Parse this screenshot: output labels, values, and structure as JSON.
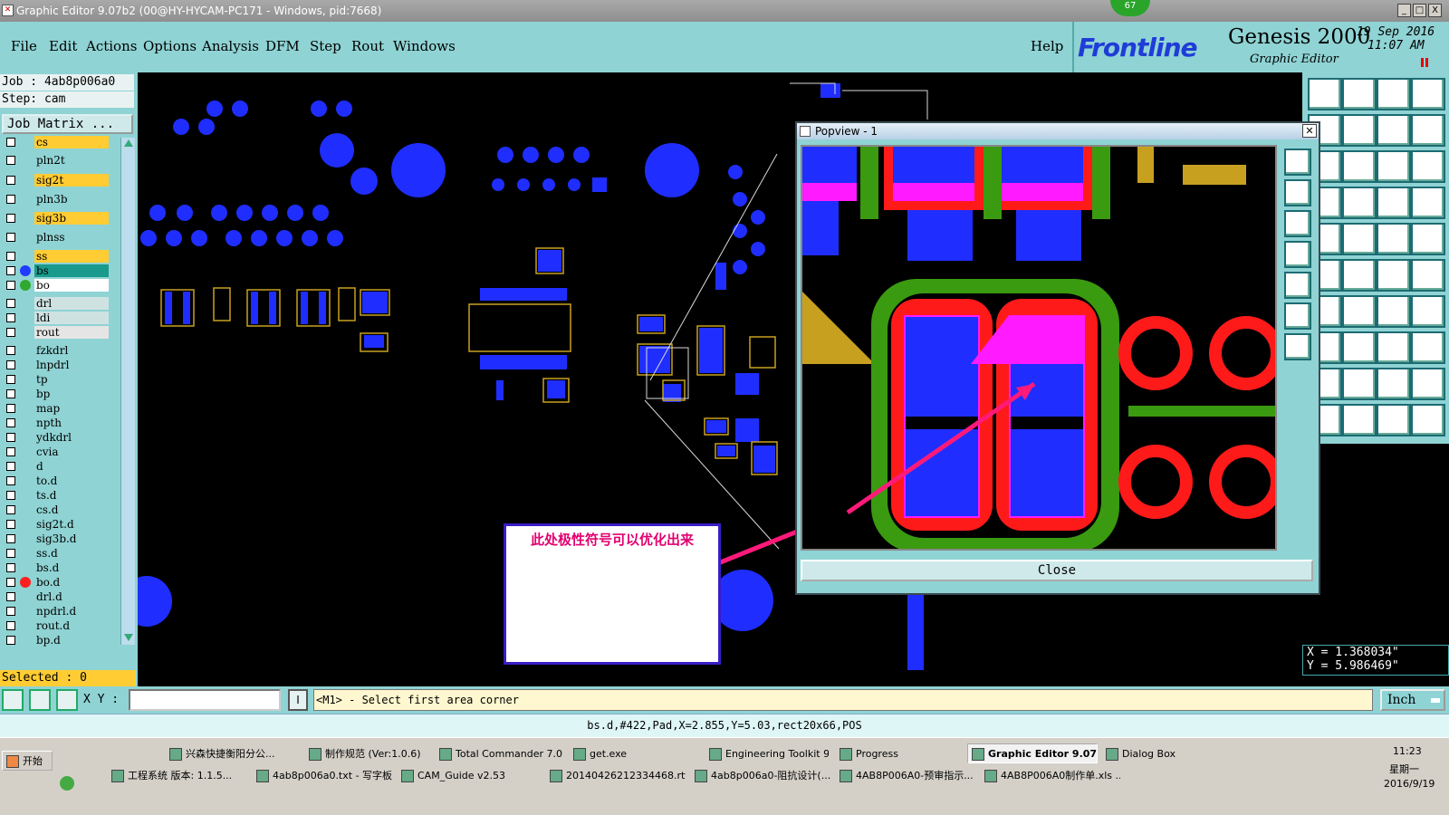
{
  "window": {
    "title": "Graphic Editor 9.07b2 (00@HY-HYCAM-PC171 - Windows, pid:7668)",
    "badge": "67",
    "btn_min": "_",
    "btn_max": "□",
    "btn_close": "X"
  },
  "menu": {
    "items": [
      "File",
      "Edit",
      "Actions",
      "Options",
      "Analysis",
      "DFM",
      "Step",
      "Rout",
      "Windows"
    ],
    "help": "Help"
  },
  "brand": {
    "logo": "Frontline",
    "product": "Genesis 2000",
    "subtitle": "Graphic Editor",
    "date": "19  Sep  2016",
    "time": "11:07  AM"
  },
  "job": {
    "job_line": "Job : 4ab8p006a0",
    "step_line": "Step: cam",
    "matrix_button": "Job Matrix ..."
  },
  "layers": [
    {
      "name": "cs",
      "color": "#ffcc33"
    },
    {
      "name": "pln2t",
      "color": "#8fd3d4"
    },
    {
      "name": "sig2t",
      "color": "#ffcc33"
    },
    {
      "name": "pln3b",
      "color": "#8fd3d4"
    },
    {
      "name": "sig3b",
      "color": "#ffcc33"
    },
    {
      "name": "plnss",
      "color": "#8fd3d4"
    },
    {
      "name": "ss",
      "color": "#ffcc33"
    },
    {
      "name": "bs",
      "color": "#1a9a8c",
      "dot": "#1f3cff"
    },
    {
      "name": "bo",
      "color": "#ffffff",
      "dot": "#2faa2f"
    },
    {
      "name": "drl",
      "color": "#cfe2e2"
    },
    {
      "name": "ldi",
      "color": "#cfe2e2"
    },
    {
      "name": "rout",
      "color": "#e5e5e5"
    },
    {
      "name": "fzkdrl",
      "color": "#8fd3d4"
    },
    {
      "name": "lnpdrl",
      "color": "#8fd3d4"
    },
    {
      "name": "tp",
      "color": "#8fd3d4"
    },
    {
      "name": "bp",
      "color": "#8fd3d4"
    },
    {
      "name": "map",
      "color": "#8fd3d4"
    },
    {
      "name": "npth",
      "color": "#8fd3d4"
    },
    {
      "name": "ydkdrl",
      "color": "#8fd3d4"
    },
    {
      "name": "cvia",
      "color": "#8fd3d4"
    },
    {
      "name": "d",
      "color": "#8fd3d4"
    },
    {
      "name": "to.d",
      "color": "#8fd3d4"
    },
    {
      "name": "ts.d",
      "color": "#8fd3d4"
    },
    {
      "name": "cs.d",
      "color": "#8fd3d4"
    },
    {
      "name": "sig2t.d",
      "color": "#8fd3d4"
    },
    {
      "name": "sig3b.d",
      "color": "#8fd3d4"
    },
    {
      "name": "ss.d",
      "color": "#8fd3d4"
    },
    {
      "name": "bs.d",
      "color": "#8fd3d4"
    },
    {
      "name": "bo.d",
      "color": "#8fd3d4",
      "dot": "#ff1f1f"
    },
    {
      "name": "drl.d",
      "color": "#8fd3d4"
    },
    {
      "name": "npdrl.d",
      "color": "#8fd3d4"
    },
    {
      "name": "rout.d",
      "color": "#8fd3d4"
    },
    {
      "name": "bp.d",
      "color": "#8fd3d4"
    }
  ],
  "selected": "Selected : 0",
  "xy_label": "X Y :",
  "prompt": "<M1> - Select first area corner",
  "unit": "Inch",
  "status": "bs.d,#422,Pad,X=2.855,Y=5.03,rect20x66,POS",
  "coords": {
    "x": "X = 1.368034\"",
    "y": "Y = 5.986469\""
  },
  "popview": {
    "title": "Popview - 1",
    "close": "Close"
  },
  "annotation": "此处极性符号可以优化出来",
  "taskbar": {
    "start": "开始",
    "row1": [
      "兴森快捷衡阳分公...",
      "制作规范 (Ver:1.0.6)",
      "Total Commander 7.0 ...",
      "get.exe",
      "Engineering Toolkit 9....",
      "Progress",
      "Graphic Editor 9.07...",
      "Dialog Box"
    ],
    "row2": [
      "工程系统  版本: 1.1.5...",
      "4ab8p006a0.txt - 写字板",
      "CAM_Guide v2.53",
      "20140426212334468.rtf...",
      "4ab8p006a0-阻抗设计(...",
      "4AB8P006A0-预审指示...",
      "4AB8P006A0制作单.xls ..."
    ],
    "clock": "11:23",
    "weekday": "星期一",
    "date": "2016/9/19"
  }
}
